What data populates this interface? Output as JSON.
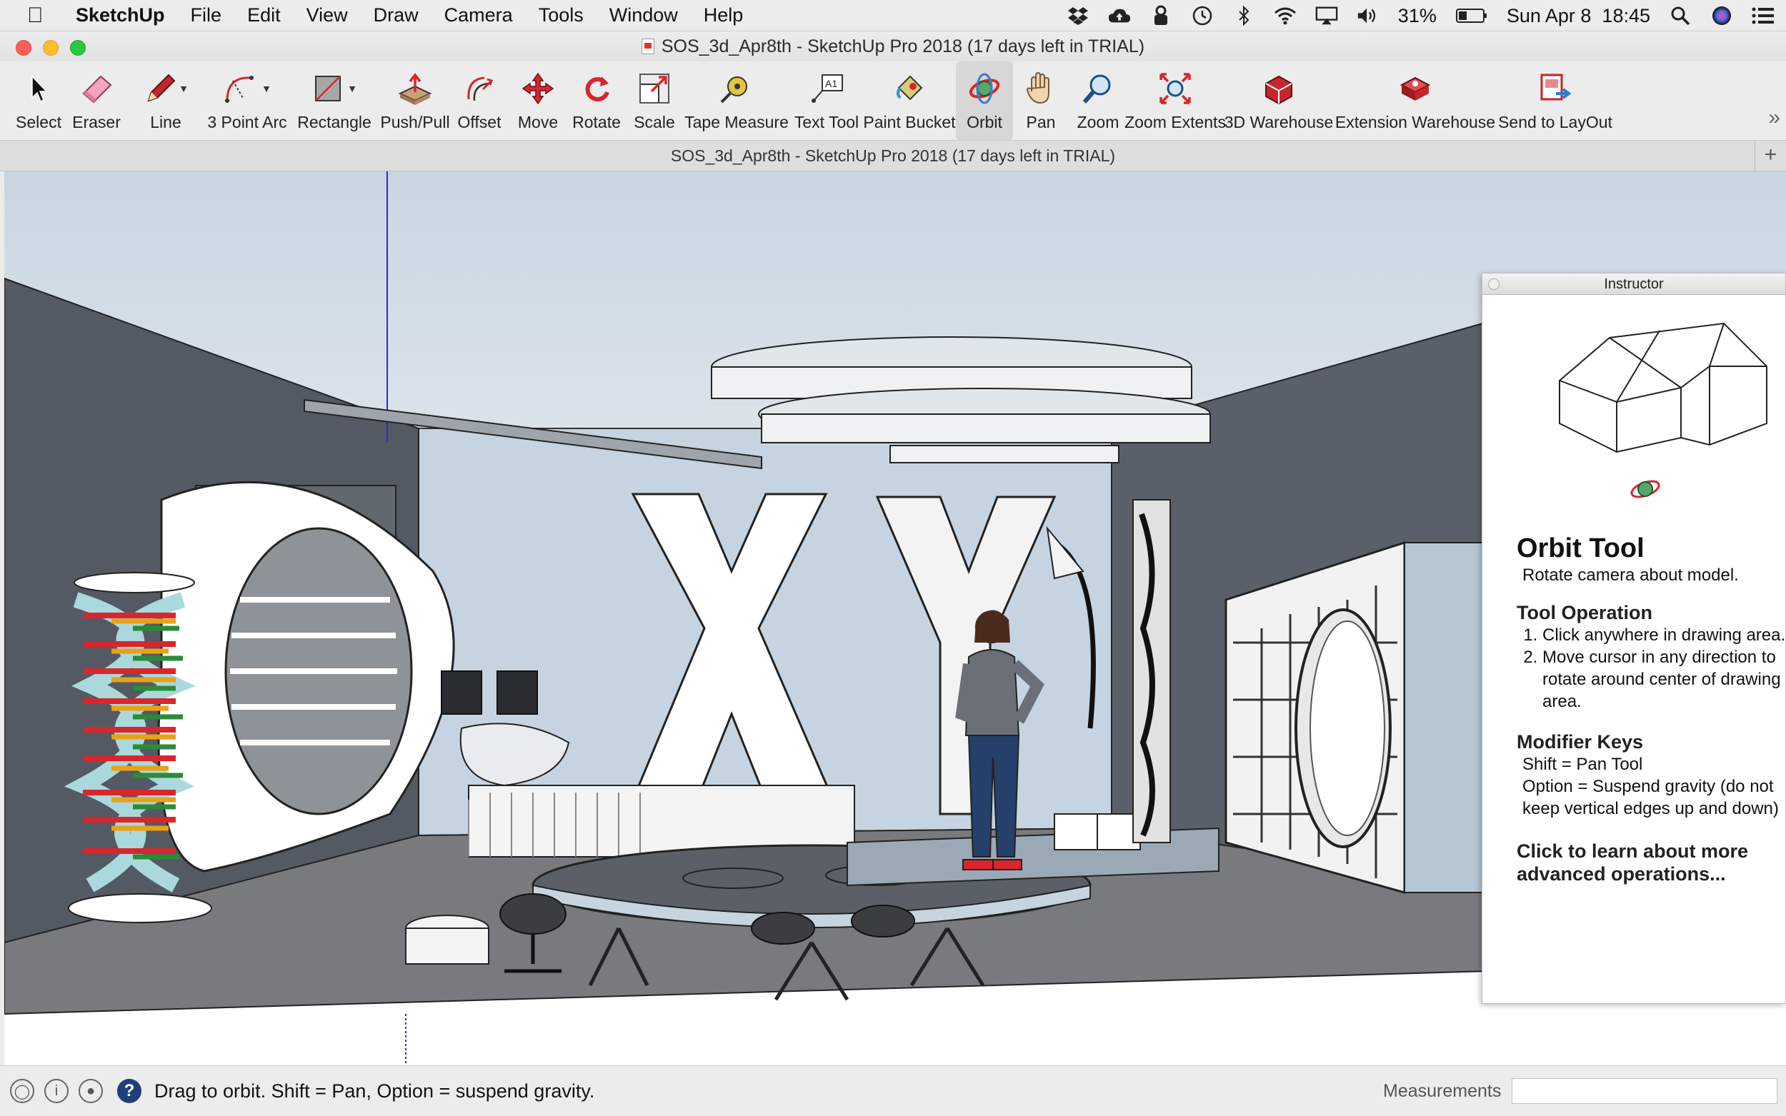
{
  "menubar": {
    "app": "SketchUp",
    "items": [
      "File",
      "Edit",
      "View",
      "Draw",
      "Camera",
      "Tools",
      "Window",
      "Help"
    ],
    "battery": "31%",
    "clock": "Sun Apr 8  18:45"
  },
  "window": {
    "title": "SOS_3d_Apr8th - SketchUp Pro 2018 (17 days left in TRIAL)",
    "tab_title": "SOS_3d_Apr8th - SketchUp Pro 2018 (17 days left in TRIAL)",
    "tab_add": "+"
  },
  "toolbar": {
    "tools": [
      {
        "id": "select",
        "label": "Select",
        "icon": "arrow-cursor-icon"
      },
      {
        "id": "eraser",
        "label": "Eraser",
        "icon": "eraser-icon"
      },
      {
        "id": "line",
        "label": "Line",
        "icon": "pencil-icon"
      },
      {
        "id": "arc",
        "label": "3 Point Arc",
        "icon": "arc-icon"
      },
      {
        "id": "rectangle",
        "label": "Rectangle",
        "icon": "rectangle-icon"
      },
      {
        "id": "pushpull",
        "label": "Push/Pull",
        "icon": "push-pull-icon"
      },
      {
        "id": "offset",
        "label": "Offset",
        "icon": "offset-icon"
      },
      {
        "id": "move",
        "label": "Move",
        "icon": "move-icon"
      },
      {
        "id": "rotate",
        "label": "Rotate",
        "icon": "rotate-icon"
      },
      {
        "id": "scale",
        "label": "Scale",
        "icon": "scale-icon"
      },
      {
        "id": "tape",
        "label": "Tape Measure",
        "icon": "tape-measure-icon"
      },
      {
        "id": "text",
        "label": "Text Tool",
        "icon": "text-tool-icon"
      },
      {
        "id": "paint",
        "label": "Paint Bucket",
        "icon": "paint-bucket-icon"
      },
      {
        "id": "orbit",
        "label": "Orbit",
        "icon": "orbit-icon"
      },
      {
        "id": "pan",
        "label": "Pan",
        "icon": "pan-hand-icon"
      },
      {
        "id": "zoom",
        "label": "Zoom",
        "icon": "zoom-icon"
      },
      {
        "id": "zoomext",
        "label": "Zoom Extents",
        "icon": "zoom-extents-icon"
      },
      {
        "id": "warehouse",
        "label": "3D Warehouse",
        "icon": "3d-warehouse-icon"
      },
      {
        "id": "extwarehouse",
        "label": "Extension Warehouse",
        "icon": "extension-warehouse-icon"
      },
      {
        "id": "layout",
        "label": "Send to LayOut",
        "icon": "send-to-layout-icon"
      }
    ],
    "active_tool": "Orbit",
    "more": "»"
  },
  "instructor": {
    "window_title": "Instructor",
    "tool_title": "Orbit Tool",
    "tool_desc": "Rotate camera about model.",
    "operation_heading": "Tool Operation",
    "steps": [
      "Click anywhere in drawing area.",
      "Move cursor in any direction to rotate around center of drawing area."
    ],
    "modifier_heading": "Modifier Keys",
    "modifiers": [
      "Shift = Pan Tool",
      "Option = Suspend gravity (do not keep vertical edges up and down)"
    ],
    "more_link": "Click to learn about more advanced operations..."
  },
  "statusbar": {
    "hint": "Drag to orbit. Shift = Pan, Option = suspend gravity.",
    "measurements_label": "Measurements",
    "measurements_value": ""
  },
  "colors": {
    "wall_dark": "#5a6069",
    "wall_light": "#c5d4e0",
    "floor": "#787a7e",
    "accent_red": "#d9262c"
  }
}
